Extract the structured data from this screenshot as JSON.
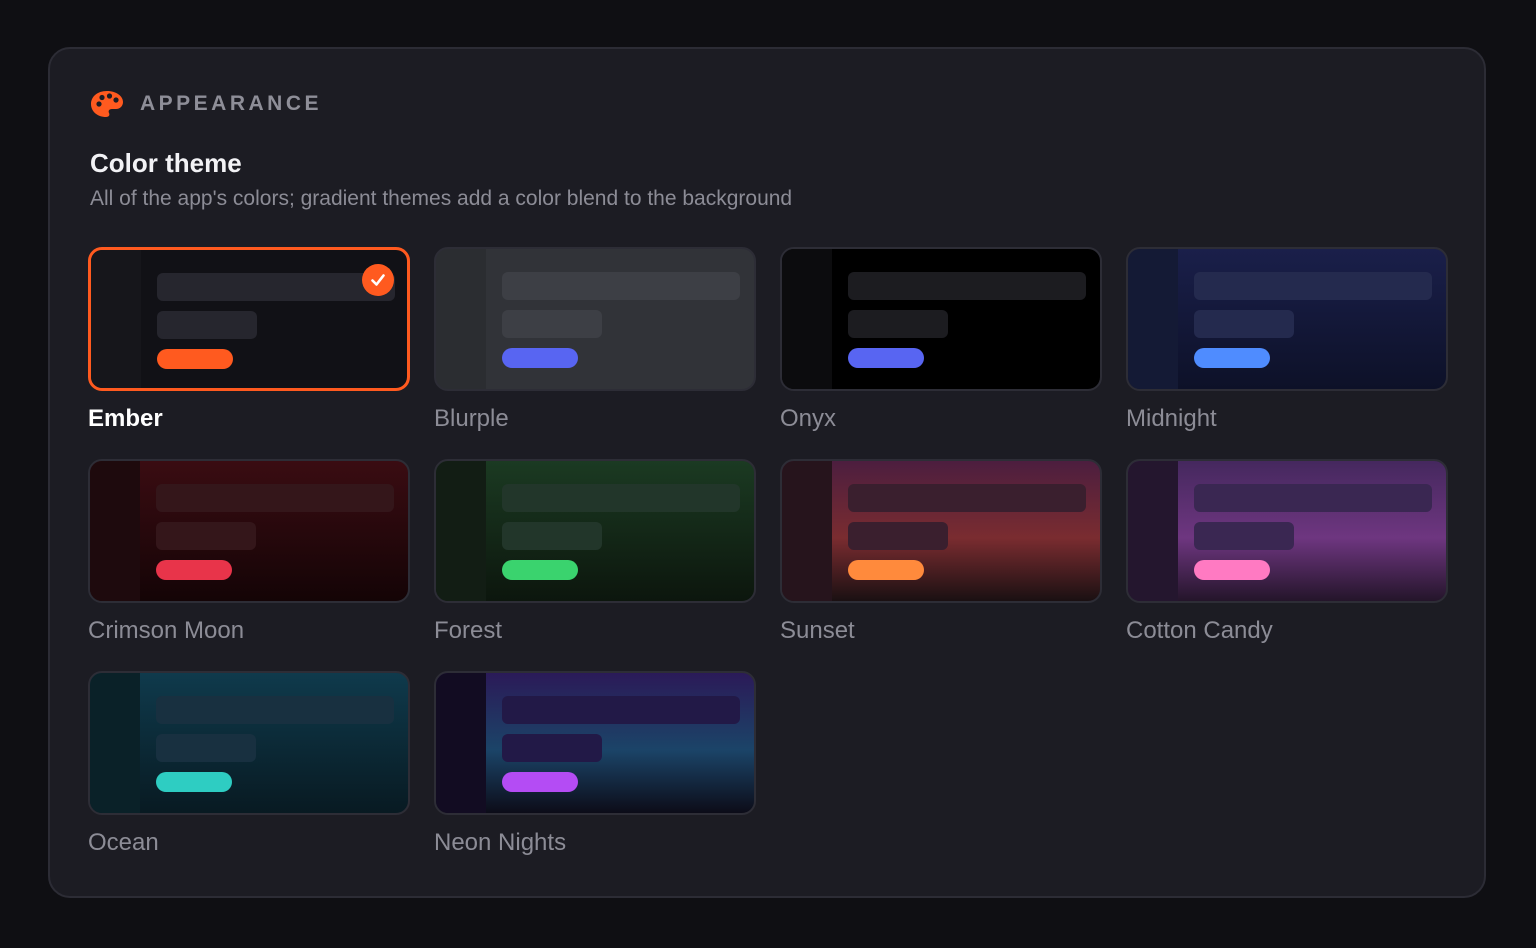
{
  "section": {
    "title": "APPEARANCE",
    "icon": "palette-icon",
    "accent": "#ff5a1f"
  },
  "setting": {
    "title": "Color theme",
    "description": "All of the app's colors; gradient themes add a color blend to the background"
  },
  "themes": [
    {
      "name": "Ember",
      "selected": true,
      "colors": {
        "bg": "#111116",
        "sidebar": "#16161b",
        "bar": "#26262e",
        "accent": "#ff5a1f"
      }
    },
    {
      "name": "Blurple",
      "selected": false,
      "colors": {
        "bg": "#313338",
        "sidebar": "#2b2d31",
        "bar": "#3d3f45",
        "accent": "#5865f2"
      }
    },
    {
      "name": "Onyx",
      "selected": false,
      "colors": {
        "bg": "#000000",
        "sidebar": "#0c0c0e",
        "bar": "#1c1c20",
        "accent": "#5865f2"
      }
    },
    {
      "name": "Midnight",
      "selected": false,
      "colors": {
        "bg": "linear-gradient(180deg,#1a1f4a 0%,#0d1128 100%)",
        "sidebar": "#141a35",
        "bar": "#242a4e",
        "accent": "#4f8cff"
      }
    },
    {
      "name": "Crimson Moon",
      "selected": false,
      "colors": {
        "bg": "linear-gradient(180deg,#3a0c12 0%,#140406 100%)",
        "sidebar": "#1e0a0d",
        "bar": "#34161a",
        "accent": "#e8344a"
      }
    },
    {
      "name": "Forest",
      "selected": false,
      "colors": {
        "bg": "linear-gradient(180deg,#1b3a22 0%,#0c160d 100%)",
        "sidebar": "#121d14",
        "bar": "#22362a",
        "accent": "#3ad36e"
      }
    },
    {
      "name": "Sunset",
      "selected": false,
      "colors": {
        "bg": "linear-gradient(180deg,#4c1e3f 0%,#7a2c30 55%,#1a1012 100%)",
        "sidebar": "#26141c",
        "bar": "#3a1f2e",
        "accent": "#ff8a3c"
      }
    },
    {
      "name": "Cotton Candy",
      "selected": false,
      "colors": {
        "bg": "linear-gradient(180deg,#45285e 0%,#6e3680 55%,#24152a 100%)",
        "sidebar": "#24162e",
        "bar": "#3a2752",
        "accent": "#ff7ac2"
      }
    },
    {
      "name": "Ocean",
      "selected": false,
      "colors": {
        "bg": "linear-gradient(180deg,#0f3a4c 0%,#081a22 100%)",
        "sidebar": "#0a2128",
        "bar": "#183040",
        "accent": "#2ecdc2"
      }
    },
    {
      "name": "Neon Nights",
      "selected": false,
      "colors": {
        "bg": "linear-gradient(180deg,#2b1a58 0%,#1b4468 55%,#0c0c18 100%)",
        "sidebar": "#120c22",
        "bar": "#221947",
        "accent": "#b44cf4"
      }
    }
  ]
}
